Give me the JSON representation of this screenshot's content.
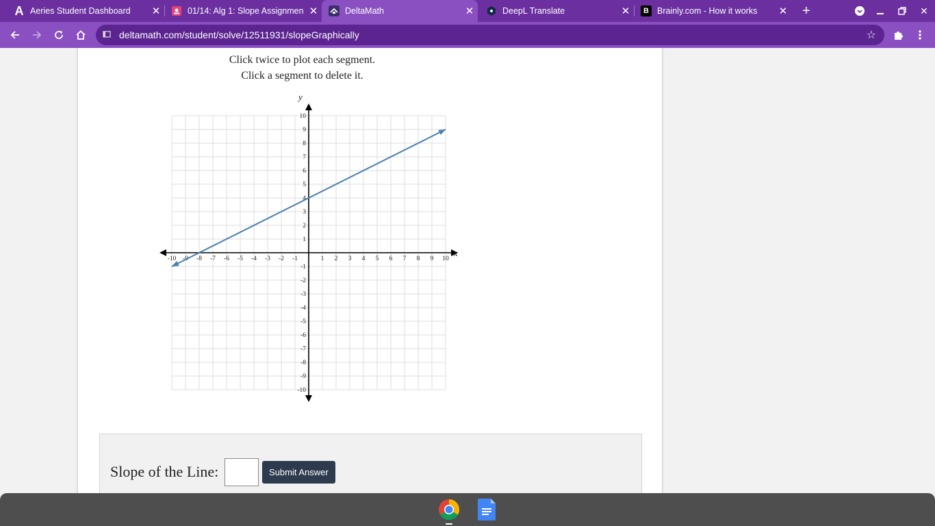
{
  "browser": {
    "tabs": [
      {
        "title": "Aeries Student Dashboard",
        "icon": "aeries-icon",
        "active": false
      },
      {
        "title": "01/14: Alg 1: Slope Assignmen",
        "icon": "classroom-icon",
        "active": false
      },
      {
        "title": "DeltaMath",
        "icon": "deltamath-icon",
        "active": true
      },
      {
        "title": "DeepL Translate",
        "icon": "deepl-icon",
        "active": false
      },
      {
        "title": "Brainly.com - How it works",
        "icon": "brainly-icon",
        "active": false
      }
    ],
    "url": "deltamath.com/student/solve/12511931/slopeGraphically",
    "accent": "#8a4fc0"
  },
  "page": {
    "instruction_line1": "Click twice to plot each segment.",
    "instruction_line2": "Click a segment to delete it.",
    "slope_label": "Slope of the Line:",
    "slope_value": "",
    "submit_label": "Submit Answer"
  },
  "graph": {
    "x_axis_label": "x",
    "y_axis_label": "y",
    "x_range": [
      -10,
      10
    ],
    "y_range": [
      -10,
      10
    ],
    "grid": true,
    "x_ticks": [
      "-10",
      "-9",
      "-8",
      "-7",
      "-6",
      "-5",
      "-4",
      "-3",
      "-2",
      "-1",
      "1",
      "2",
      "3",
      "4",
      "5",
      "6",
      "7",
      "8",
      "9",
      "10"
    ],
    "y_ticks": [
      "10",
      "9",
      "8",
      "7",
      "6",
      "5",
      "4",
      "3",
      "2",
      "1",
      "-1",
      "-2",
      "-3",
      "-4",
      "-5",
      "-6",
      "-7",
      "-8",
      "-9",
      "-10"
    ],
    "line": {
      "x1": -10,
      "y1": -1,
      "x2": 10,
      "y2": 9,
      "color": "#4a7fb0"
    }
  },
  "shelf": {
    "apps": [
      "chrome-icon",
      "google-docs-icon"
    ]
  }
}
